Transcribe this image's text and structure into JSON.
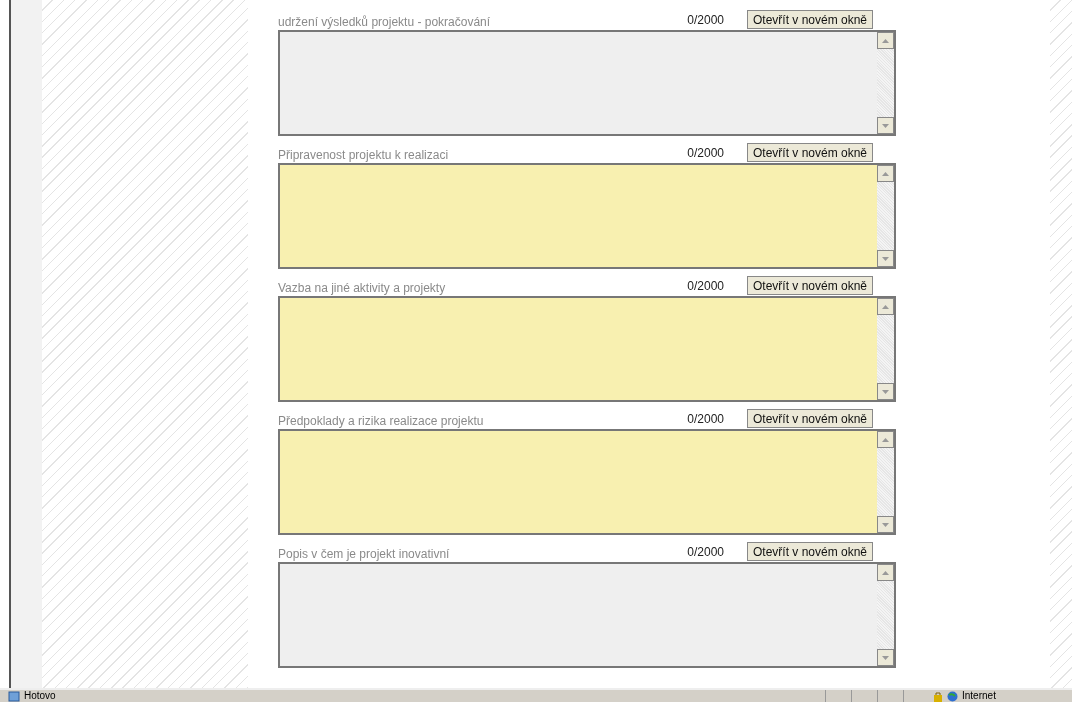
{
  "fields": [
    {
      "label": "udržení výsledků projektu - pokračování",
      "counter": "0/2000",
      "button": "Otevřít v novém okně",
      "highlighted": false
    },
    {
      "label": "Připravenost projektu k realizaci",
      "counter": "0/2000",
      "button": "Otevřít v novém okně",
      "highlighted": true
    },
    {
      "label": "Vazba na jiné aktivity a projekty",
      "counter": "0/2000",
      "button": "Otevřít v novém okně",
      "highlighted": true
    },
    {
      "label": "Předpoklady a rizika realizace projektu",
      "counter": "0/2000",
      "button": "Otevřít v novém okně",
      "highlighted": true
    },
    {
      "label": "Popis v čem je projekt inovativní",
      "counter": "0/2000",
      "button": "Otevřít v novém okně",
      "highlighted": false
    }
  ],
  "status_bar": {
    "status": "Hotovo",
    "zone": "Internet"
  }
}
